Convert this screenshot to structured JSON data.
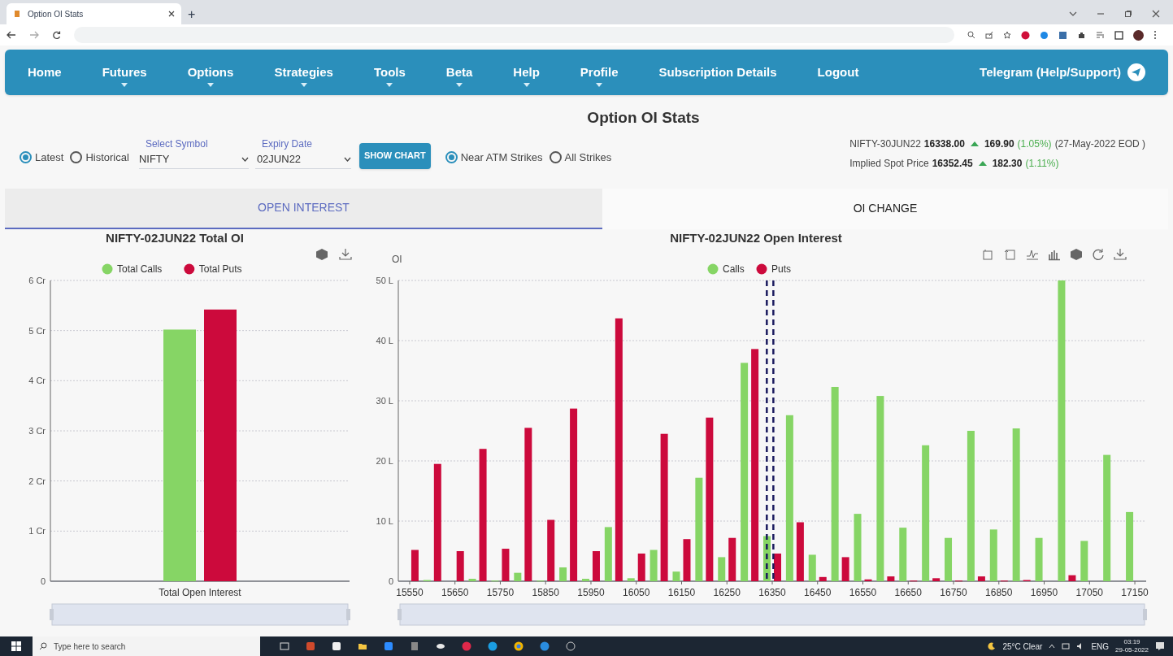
{
  "browser": {
    "tab_title": "Option OI Stats",
    "new_tab": "+"
  },
  "nav": [
    {
      "label": "Home",
      "dropdown": false
    },
    {
      "label": "Futures",
      "dropdown": true
    },
    {
      "label": "Options",
      "dropdown": true
    },
    {
      "label": "Strategies",
      "dropdown": true
    },
    {
      "label": "Tools",
      "dropdown": true
    },
    {
      "label": "Beta",
      "dropdown": true
    },
    {
      "label": "Help",
      "dropdown": true
    },
    {
      "label": "Profile",
      "dropdown": true
    },
    {
      "label": "Subscription Details",
      "dropdown": false
    },
    {
      "label": "Logout",
      "dropdown": false
    }
  ],
  "telegram_link": "Telegram (Help/Support)",
  "page_title": "Option OI Stats",
  "mode_options": [
    {
      "label": "Latest",
      "selected": true
    },
    {
      "label": "Historical",
      "selected": false
    }
  ],
  "symbol": {
    "label": "Select Symbol",
    "value": "NIFTY"
  },
  "expiry": {
    "label": "Expiry Date",
    "value": "02JUN22"
  },
  "show_chart_button": "SHOW CHART",
  "strike_options": [
    {
      "label": "Near ATM Strikes",
      "selected": true
    },
    {
      "label": "All Strikes",
      "selected": false
    }
  ],
  "quotes": [
    {
      "name": "NIFTY-30JUN22",
      "price": "16338.00",
      "change": "169.90",
      "change_pct": "(1.05%)",
      "note": "(27-May-2022 EOD )"
    },
    {
      "name": "Implied Spot Price",
      "price": "16352.45",
      "change": "182.30",
      "change_pct": "(1.11%)"
    }
  ],
  "tabs": [
    {
      "label": "OPEN INTEREST",
      "selected": true
    },
    {
      "label": "OI CHANGE",
      "selected": false
    }
  ],
  "total_oi_chart": {
    "chart_data": {
      "type": "bar",
      "title": "NIFTY-02JUN22 Total OI",
      "categories": [
        "Total Open Interest"
      ],
      "series": [
        {
          "name": "Total Calls",
          "color": "#86d565",
          "values": [
            5.02
          ]
        },
        {
          "name": "Total Puts",
          "color": "#cc0a3c",
          "values": [
            5.42
          ]
        }
      ],
      "ylim": [
        0,
        6
      ],
      "grid": true,
      "legend": "top",
      "yticks": [
        {
          "value": 0,
          "label": "0"
        },
        {
          "value": 1,
          "label": "1 Cr"
        },
        {
          "value": 2,
          "label": "2 Cr"
        },
        {
          "value": 3,
          "label": "3 Cr"
        },
        {
          "value": 4,
          "label": "4 Cr"
        },
        {
          "value": 5,
          "label": "5 Cr"
        },
        {
          "value": 6,
          "label": "6 Cr"
        }
      ]
    }
  },
  "oi_chart": {
    "chart_data": {
      "type": "bar",
      "title": "NIFTY-02JUN22 Open Interest",
      "ylabel": "OI",
      "x": [
        15550,
        15600,
        15650,
        15700,
        15750,
        15800,
        15850,
        15900,
        15950,
        16000,
        16050,
        16100,
        16150,
        16200,
        16250,
        16300,
        16350,
        16400,
        16450,
        16500,
        16550,
        16600,
        16650,
        16700,
        16750,
        16800,
        16850,
        16900,
        16950,
        17000,
        17050,
        17100,
        17150
      ],
      "series": [
        {
          "name": "Calls",
          "color": "#86d565",
          "values": [
            0,
            0.2,
            0,
            0.4,
            0.1,
            1.4,
            0.1,
            2.3,
            0.4,
            9,
            0.5,
            5.2,
            1.6,
            17.2,
            4,
            36.3,
            7.5,
            27.6,
            4.4,
            32.3,
            11.2,
            30.8,
            8.9,
            22.6,
            7.2,
            25,
            8.6,
            25.4,
            7.2,
            50,
            6.7,
            21,
            11.5
          ]
        },
        {
          "name": "Puts",
          "color": "#cc0a3c",
          "values": [
            5.2,
            19.5,
            5,
            22,
            5.4,
            25.5,
            10.2,
            28.7,
            5,
            43.7,
            4.6,
            24.5,
            7,
            27.2,
            7.2,
            38.6,
            4.6,
            9.8,
            0.7,
            4,
            0.3,
            0.8,
            0.1,
            0.5,
            0.1,
            0.8,
            0.1,
            0.2,
            0,
            1,
            0,
            0,
            0
          ]
        }
      ],
      "xlim": [
        15525,
        17175
      ],
      "ylim": [
        0,
        50
      ],
      "grid": true,
      "legend": "top",
      "xticks": [
        15550,
        15650,
        15750,
        15850,
        15950,
        16050,
        16150,
        16250,
        16350,
        16450,
        16550,
        16650,
        16750,
        16850,
        16950,
        17050,
        17150
      ],
      "yticks": [
        {
          "value": 0,
          "label": "0"
        },
        {
          "value": 10,
          "label": "10 L"
        },
        {
          "value": 20,
          "label": "20 L"
        },
        {
          "value": 30,
          "label": "30 L"
        },
        {
          "value": 40,
          "label": "40 L"
        },
        {
          "value": 50,
          "label": "50 L"
        }
      ],
      "ref_lines": [
        {
          "axis": "x",
          "value": 16338
        },
        {
          "axis": "x",
          "value": 16352.45
        }
      ]
    }
  },
  "taskbar": {
    "search_placeholder": "Type here to search",
    "weather": "25°C Clear",
    "language": "ENG",
    "time": "03:19",
    "date": "29-05-2022"
  }
}
